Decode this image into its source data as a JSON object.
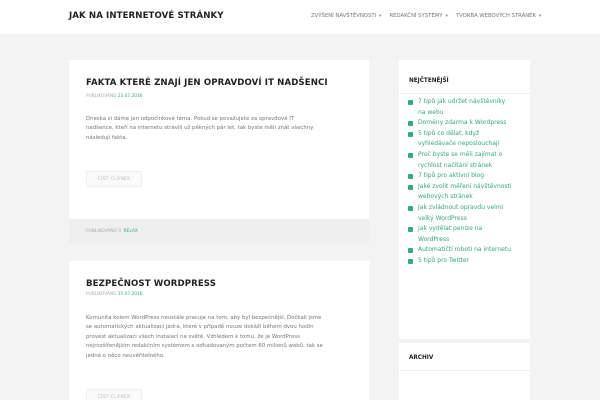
{
  "site": {
    "title": "JAK NA INTERNETOVÉ STRÁNKY"
  },
  "nav": {
    "items": [
      {
        "label": "ZVÝŠENÍ NÁVŠTĚVNOSTI"
      },
      {
        "label": "REDAKČNÍ SYSTÉMY"
      },
      {
        "label": "TVORBA WEBOVÝCH STRÁNEK"
      }
    ]
  },
  "posts": [
    {
      "title": "FAKTA KTERÉ ZNAJÍ JEN OPRAVDOVÍ IT NADŠENCI",
      "meta_prefix": "PUBLIKOVÁNO",
      "date": "23.07.2016",
      "excerpt_lines": [
        "Dneska si dáme jen odpočinkové téma. Pokud se považujete za opravdové IT",
        "nadšence, kteří na internetu strávili už pěkných pár let, tak byste měli znát všechny",
        "následují fakta."
      ],
      "button": "ČÍST ČLÁNEK",
      "footer_prefix": "PUBLIKOVÁNO V",
      "category": "RELAX"
    },
    {
      "title": "BEZPEČNOST WORDPRESS",
      "meta_prefix": "PUBLIKOVÁNO",
      "date": "15.07.2016",
      "excerpt_lines": [
        "Komunita kolem WordPress neustále pracuje na tom, aby byl bezpečnější. Dočkali jsme",
        "se automatických aktualizací jádra, které v případě nouze dokáží během dvou hodin",
        "provést aktualizaci všech instalací na světě. Vzhledem k tomu, že je WordPress",
        "nejrozšířenějším redakčním systémem s odhadovaným počtem 60 milionů webů, tak se",
        "jedná o něco neuvěřitelného."
      ],
      "button": "ČÍST ČLÁNEK"
    }
  ],
  "sidebar": {
    "popular": {
      "title": "NEJČTENĚJŠÍ",
      "items": [
        [
          "7 tipů jak udržet návštěvníky",
          "na webu"
        ],
        [
          "Domény zdarma k Wordpress"
        ],
        [
          "5 tipů co dělat, když",
          "vyhledávače neposlouchají"
        ],
        [
          "Proč byste se měli zajímat o",
          "rychlost načítání stránek"
        ],
        [
          "7 tipů pro aktivní blog"
        ],
        [
          "Jaké zvolit měření návštěvnosti",
          "webových stránek"
        ],
        [
          "Jak zvládnout opravdu velmi",
          "velký WordPress"
        ],
        [
          "Jak vydělat peníze na",
          "WordPress"
        ],
        [
          "Automatičtí roboti na internetu"
        ],
        [
          "5 tipů pro Twitter"
        ]
      ]
    },
    "archive": {
      "title": "ARCHIV"
    }
  },
  "colors": {
    "accent": "#35a87f",
    "background": "#f3f3f3",
    "card": "#ffffff"
  }
}
